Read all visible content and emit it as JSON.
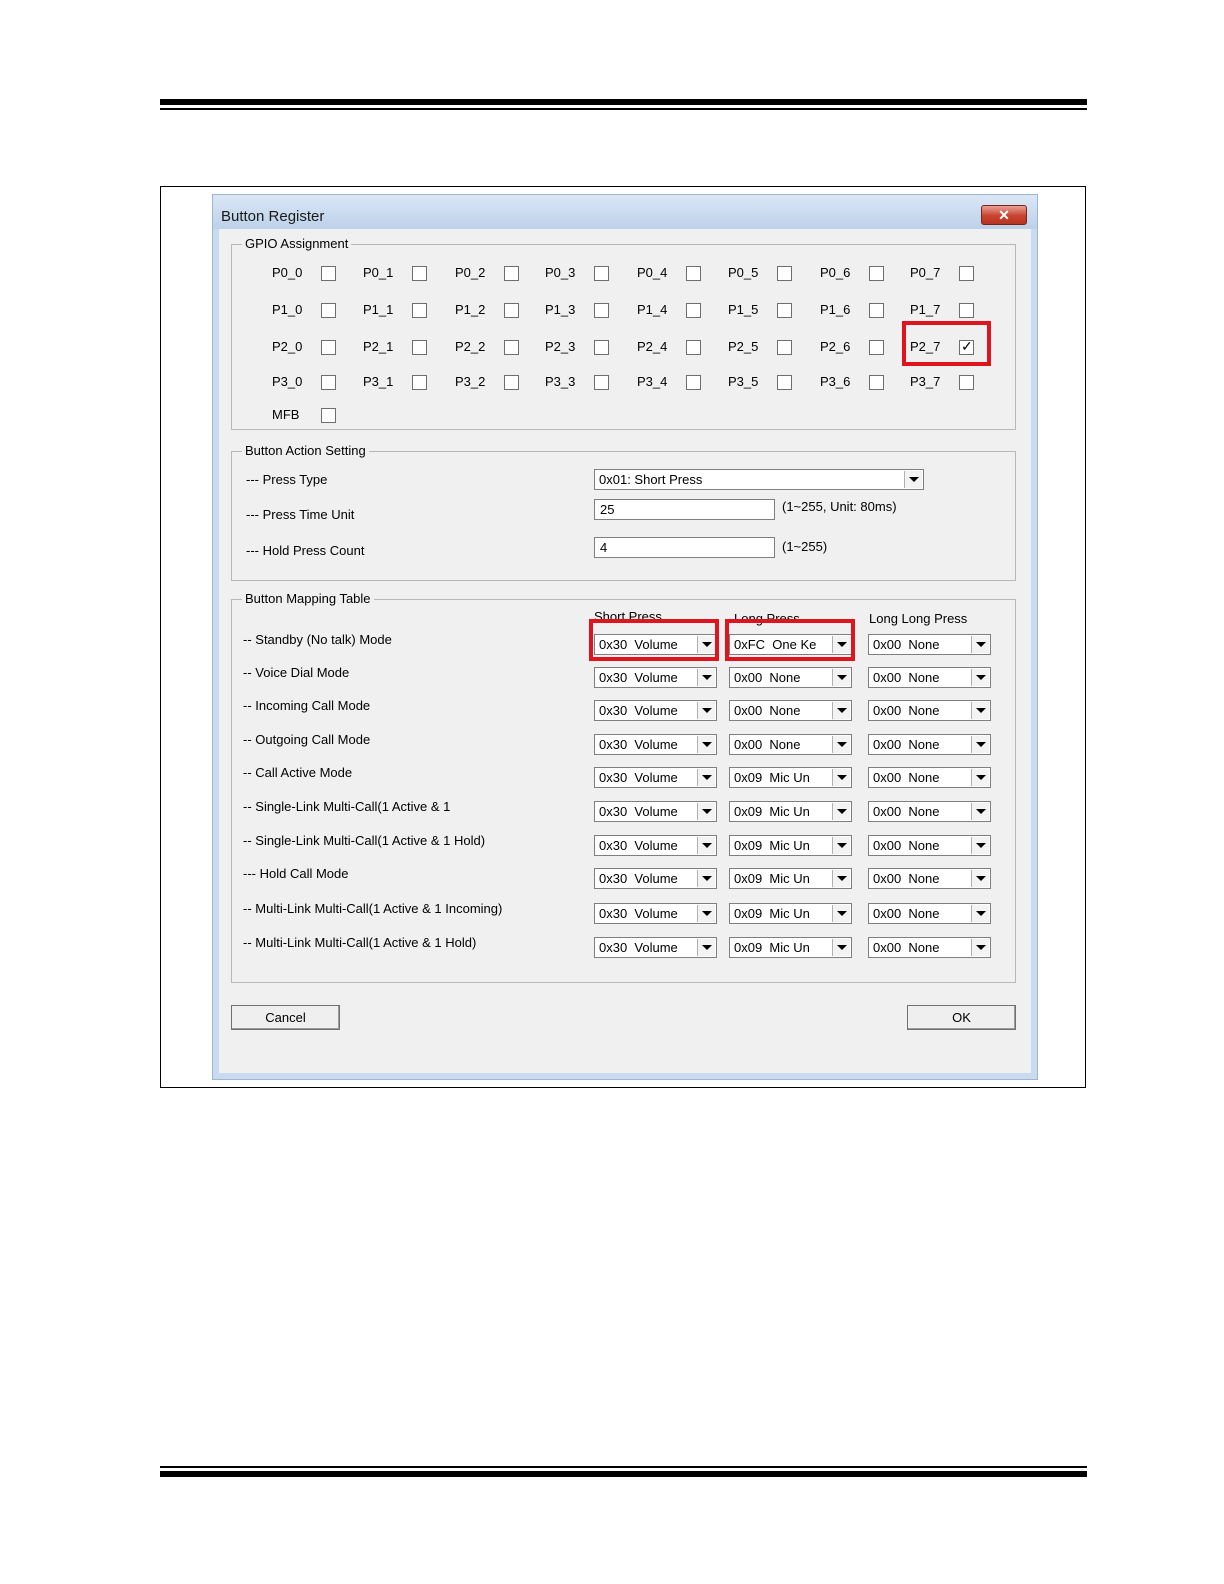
{
  "dialog": {
    "title": "Button Register",
    "close_glyph": "✕"
  },
  "gpio": {
    "legend": "GPIO Assignment",
    "pins": [
      {
        "label": "P0_0",
        "checked": false
      },
      {
        "label": "P0_1",
        "checked": false
      },
      {
        "label": "P0_2",
        "checked": false
      },
      {
        "label": "P0_3",
        "checked": false
      },
      {
        "label": "P0_4",
        "checked": false
      },
      {
        "label": "P0_5",
        "checked": false
      },
      {
        "label": "P0_6",
        "checked": false
      },
      {
        "label": "P0_7",
        "checked": false
      },
      {
        "label": "P1_0",
        "checked": false
      },
      {
        "label": "P1_1",
        "checked": false
      },
      {
        "label": "P1_2",
        "checked": false
      },
      {
        "label": "P1_3",
        "checked": false
      },
      {
        "label": "P1_4",
        "checked": false
      },
      {
        "label": "P1_5",
        "checked": false
      },
      {
        "label": "P1_6",
        "checked": false
      },
      {
        "label": "P1_7",
        "checked": false
      },
      {
        "label": "P2_0",
        "checked": false
      },
      {
        "label": "P2_1",
        "checked": false
      },
      {
        "label": "P2_2",
        "checked": false
      },
      {
        "label": "P2_3",
        "checked": false
      },
      {
        "label": "P2_4",
        "checked": false
      },
      {
        "label": "P2_5",
        "checked": false
      },
      {
        "label": "P2_6",
        "checked": false
      },
      {
        "label": "P2_7",
        "checked": true
      },
      {
        "label": "P3_0",
        "checked": false
      },
      {
        "label": "P3_1",
        "checked": false
      },
      {
        "label": "P3_2",
        "checked": false
      },
      {
        "label": "P3_3",
        "checked": false
      },
      {
        "label": "P3_4",
        "checked": false
      },
      {
        "label": "P3_5",
        "checked": false
      },
      {
        "label": "P3_6",
        "checked": false
      },
      {
        "label": "P3_7",
        "checked": false
      },
      {
        "label": "MFB",
        "checked": false
      }
    ]
  },
  "action": {
    "legend": "Button Action Setting",
    "press_type_label": "--- Press Type",
    "press_type_value": "0x01: Short Press",
    "press_time_label": "--- Press Time Unit",
    "press_time_value": "25",
    "press_time_hint": "(1~255, Unit: 80ms)",
    "hold_count_label": "--- Hold Press Count",
    "hold_count_value": "4",
    "hold_count_hint": "(1~255)"
  },
  "mapping": {
    "legend": "Button Mapping Table",
    "headers": [
      "Short Press",
      "Long Press",
      "Long Long Press"
    ],
    "rows": [
      {
        "label": "-- Standby (No talk) Mode",
        "short": "0x30  Volume",
        "long": "0xFC  One Ke",
        "longlong": "0x00  None"
      },
      {
        "label": "-- Voice Dial Mode",
        "short": "0x30  Volume",
        "long": "0x00  None",
        "longlong": "0x00  None"
      },
      {
        "label": "-- Incoming Call Mode",
        "short": "0x30  Volume",
        "long": "0x00  None",
        "longlong": "0x00  None"
      },
      {
        "label": "-- Outgoing Call Mode",
        "short": "0x30  Volume",
        "long": "0x00  None",
        "longlong": "0x00  None"
      },
      {
        "label": "-- Call Active Mode",
        "short": "0x30  Volume",
        "long": "0x09  Mic Un",
        "longlong": "0x00  None"
      },
      {
        "label": "-- Single-Link Multi-Call(1 Active & 1",
        "short": "0x30  Volume",
        "long": "0x09  Mic Un",
        "longlong": "0x00  None"
      },
      {
        "label": "-- Single-Link Multi-Call(1 Active & 1 Hold)",
        "short": "0x30  Volume",
        "long": "0x09  Mic Un",
        "longlong": "0x00  None"
      },
      {
        "label": "--- Hold Call Mode",
        "short": "0x30  Volume",
        "long": "0x09  Mic Un",
        "longlong": "0x00  None"
      },
      {
        "label": "-- Multi-Link Multi-Call(1 Active & 1 Incoming)",
        "short": "0x30  Volume",
        "long": "0x09  Mic Un",
        "longlong": "0x00  None"
      },
      {
        "label": "-- Multi-Link Multi-Call(1 Active & 1 Hold)",
        "short": "0x30  Volume",
        "long": "0x09  Mic Un",
        "longlong": "0x00  None"
      }
    ]
  },
  "buttons": {
    "cancel": "Cancel",
    "ok": "OK"
  },
  "colors": {
    "highlight": "#e0141e",
    "title_bar": "#c9dbef",
    "client_bg": "#f0f0f0"
  }
}
